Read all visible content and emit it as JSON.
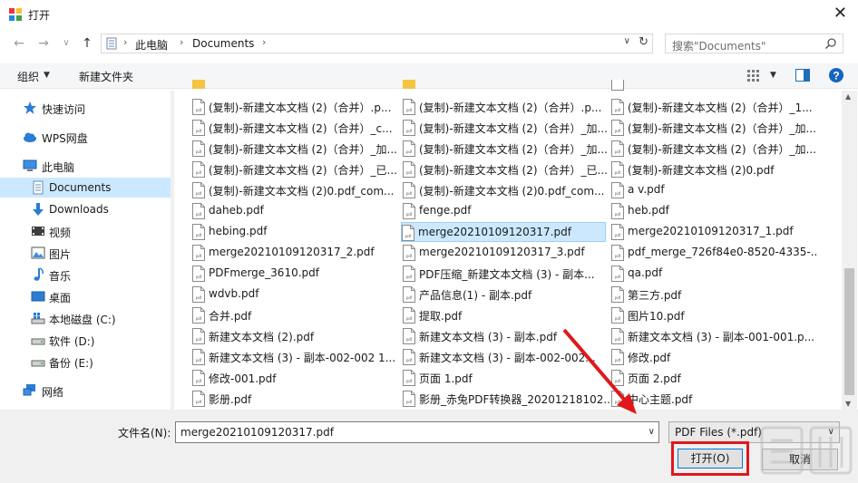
{
  "window": {
    "title": "打开"
  },
  "nav": {
    "back": "←",
    "forward": "→",
    "recent": "∨",
    "up": "↑"
  },
  "breadcrumbs": [
    "此电脑",
    "Documents"
  ],
  "search": {
    "placeholder": "搜索\"Documents\""
  },
  "toolbar": {
    "organize": "组织",
    "new_folder": "新建文件夹"
  },
  "sidebar": {
    "items": [
      {
        "label": "快速访问",
        "icon": "star-icon"
      },
      {
        "label": "WPS网盘",
        "icon": "cloud-icon"
      },
      {
        "label": "此电脑",
        "icon": "computer-icon"
      },
      {
        "label": "Documents",
        "icon": "documents-icon",
        "selected": true
      },
      {
        "label": "Downloads",
        "icon": "download-icon"
      },
      {
        "label": "视频",
        "icon": "video-icon"
      },
      {
        "label": "图片",
        "icon": "picture-icon"
      },
      {
        "label": "音乐",
        "icon": "music-icon"
      },
      {
        "label": "桌面",
        "icon": "desktop-icon"
      },
      {
        "label": "本地磁盘 (C:)",
        "icon": "drive-icon"
      },
      {
        "label": "软件 (D:)",
        "icon": "drive-icon"
      },
      {
        "label": "备份 (E:)",
        "icon": "drive-icon"
      },
      {
        "label": "网络",
        "icon": "network-icon"
      }
    ]
  },
  "files": {
    "col1": [
      "(复制)-新建文本文档 (2)（合并）.p...",
      "(复制)-新建文本文档 (2)（合并）_c...",
      "(复制)-新建文本文档 (2)（合并）_加...",
      "(复制)-新建文本文档 (2)（合并）_已...",
      "(复制)-新建文本文档 (2)0.pdf_com...",
      "daheb.pdf",
      "hebing.pdf",
      "merge20210109120317_2.pdf",
      "PDFmerge_3610.pdf",
      "wdvb.pdf",
      "合并.pdf",
      "新建文本文档 (2).pdf",
      "新建文本文档 (3) - 副本-002-002 1...",
      "修改-001.pdf",
      "影册.pdf"
    ],
    "col2": [
      "(复制)-新建文本文档 (2)（合并）.p...",
      "(复制)-新建文本文档 (2)（合并）_加...",
      "(复制)-新建文本文档 (2)（合并）_加...",
      "(复制)-新建文本文档 (2)（合并）_已...",
      "(复制)-新建文本文档 (2)0.pdf_com...",
      "fenge.pdf",
      "merge20210109120317.pdf",
      "merge20210109120317_3.pdf",
      "PDF压缩_新建文本文档 (3) - 副本...",
      "产品信息(1) - 副本.pdf",
      "提取.pdf",
      "新建文本文档 (3) - 副本.pdf",
      "新建文本文档 (3) - 副本-002-002...",
      "页面 1.pdf",
      "影册_赤兔PDF转换器_20201218102..."
    ],
    "col3": [
      "(复制)-新建文本文档 (2)（合并）_1...",
      "(复制)-新建文本文档 (2)（合并）_加...",
      "(复制)-新建文本文档 (2)（合并）_加...",
      "(复制)-新建文本文档 (2)0.pdf",
      "a v.pdf",
      "heb.pdf",
      "merge20210109120317_1.pdf",
      "pdf_merge_726f84e0-8520-4335-...",
      "qa.pdf",
      "第三方.pdf",
      "图片10.pdf",
      "新建文本文档 (3) - 副本-001-001.p...",
      "修改.pdf",
      "页面 2.pdf",
      "中心主题.pdf"
    ],
    "selected": "merge20210109120317.pdf"
  },
  "bottom": {
    "filename_label": "文件名(N):",
    "filename_value": "merge20210109120317.pdf",
    "filetype_value": "PDF Files (*.pdf)",
    "open_button": "打开(O)",
    "cancel_button": "取消"
  },
  "colors": {
    "selected_bg": "#cce8ff",
    "highlight_red": "#e0181b",
    "accent_blue": "#0078d7"
  }
}
